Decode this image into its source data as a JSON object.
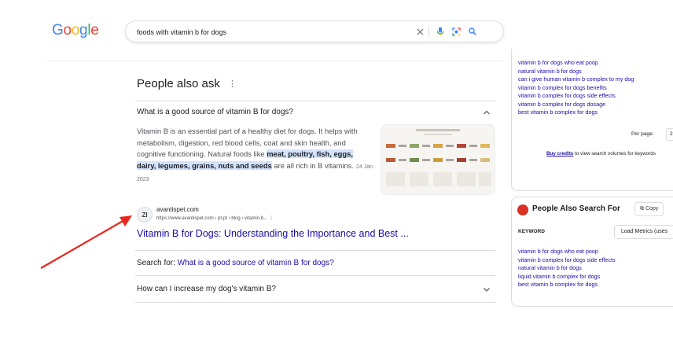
{
  "header": {
    "logo_letters": [
      "G",
      "o",
      "o",
      "g",
      "l",
      "e"
    ],
    "search_value": "foods with vitamin b for dogs"
  },
  "paa": {
    "title": "People also ask",
    "menu_glyph": "⋮",
    "question_1": "What is a good source of vitamin B for dogs?",
    "answer_part_1": "Vitamin B is an essential part of a healthy diet for dogs. It helps with metabolism, digestion, red blood cells, coat and skin health, and cognitive functioning. Natural foods like ",
    "answer_highlight": "meat, poultry, fish, eggs, dairy, legumes, grains, nuts and seeds",
    "answer_part_2": " are all rich in B vitamins.",
    "answer_date": "24 Jan 2023",
    "source_icon": "ZI",
    "source_name": "avantispet.com",
    "source_url": "https://www.avantispet.com › pt-pt › blog › vitamin-b... ⋮",
    "result_title": "Vitamin B for Dogs: Understanding the Importance and Best ...",
    "search_for_label": "Search for: ",
    "search_for_link": "What is a good source of vitamin B for dogs?",
    "question_2": "How can I increase my dog's vitamin B?"
  },
  "keywords_panel": {
    "items": [
      "vitamin b for dogs who eat poop",
      "natural vitamin b for dogs",
      "can i give human vitamin b complex to my dog",
      "vitamin b complex for dogs benefits",
      "vitamin b complex for dogs side effects",
      "vitamin b complex for dogs dosage",
      "best vitamin b complex for dogs"
    ],
    "per_page_label": "Per page:",
    "per_page_value": "2",
    "credits_link": "Buy credits",
    "credits_text": " to view search volumes for keywords"
  },
  "pasf_panel": {
    "title": "People Also Search For",
    "copy_label": "⧉ Copy",
    "keyword_header": "KEYWORD",
    "load_label": "Load Metrics (uses",
    "items": [
      "vitamin b for dogs who eat poop",
      "vitamin b complex for dogs side effects",
      "natural vitamin b for dogs",
      "liquid vitamin b complex for dogs",
      "best vitamin b complex for dogs"
    ]
  },
  "colors": {
    "link": "#1a0dab",
    "arrow": "#e8261d",
    "highlight": "#d3e3fd"
  },
  "icons": [
    "clear-icon",
    "microphone-icon",
    "lens-icon",
    "search-icon",
    "chevron-up-icon",
    "chevron-down-icon",
    "red-arrow"
  ]
}
